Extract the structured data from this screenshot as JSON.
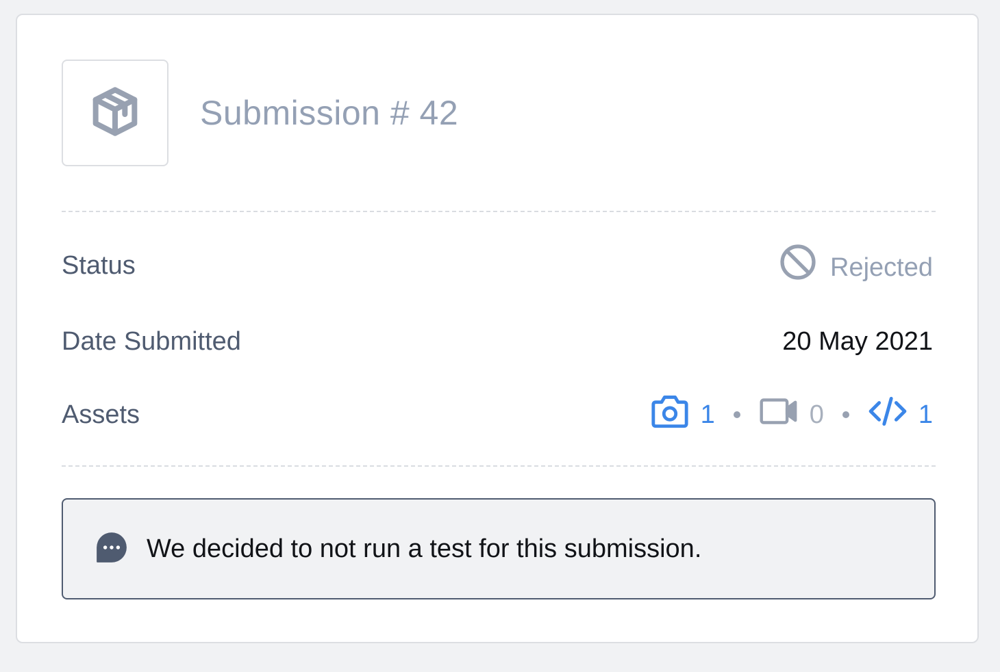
{
  "submission": {
    "title": "Submission # 42",
    "icon": "package-icon"
  },
  "details": {
    "status_label": "Status",
    "status_value": "Rejected",
    "status_icon": "ban-icon",
    "date_label": "Date Submitted",
    "date_value": "20 May 2021",
    "assets_label": "Assets",
    "assets": [
      {
        "icon": "camera-icon",
        "count": "1",
        "color": "#3b86e8"
      },
      {
        "icon": "video-icon",
        "count": "0",
        "color": "#a8b0bd"
      },
      {
        "icon": "code-icon",
        "count": "1",
        "color": "#3b86e8"
      }
    ]
  },
  "message": {
    "icon": "chat-bubble-icon",
    "text": "We decided to not run a test for this submission."
  },
  "colors": {
    "accent": "#3b86e8",
    "muted": "#94a0b4",
    "label": "#4f5b70"
  }
}
